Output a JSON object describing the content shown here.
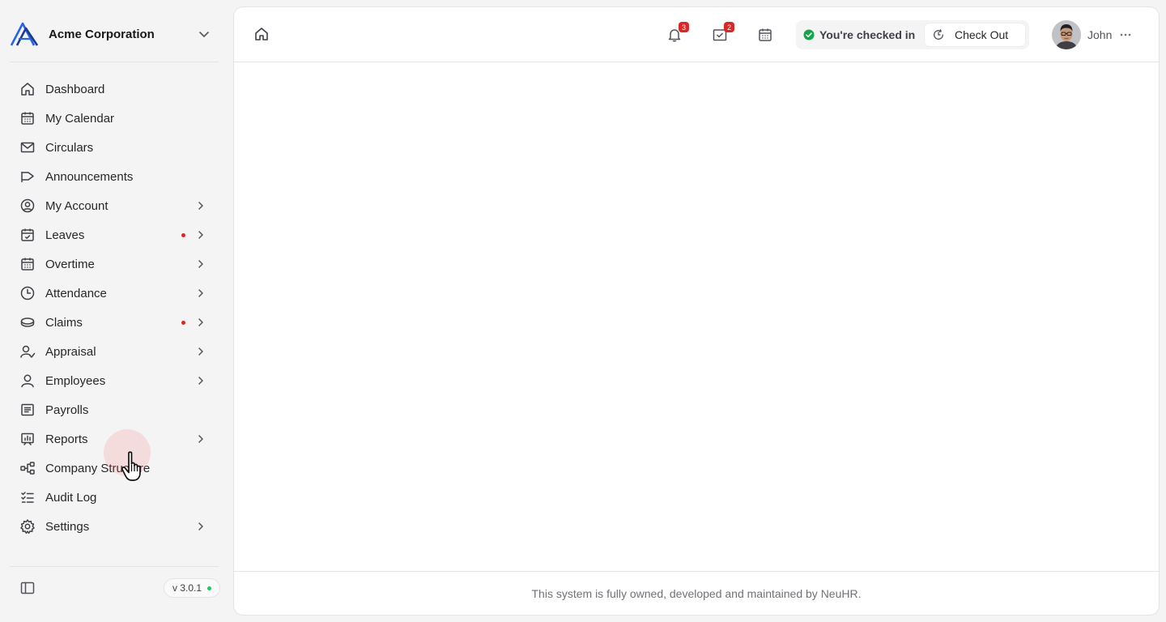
{
  "org": {
    "name": "Acme Corporation",
    "logo_color": "#2563eb"
  },
  "sidebar": {
    "items": [
      {
        "label": "Dashboard",
        "icon": "home-icon",
        "chevron": false,
        "dot": false
      },
      {
        "label": "My Calendar",
        "icon": "calendar-icon",
        "chevron": false,
        "dot": false
      },
      {
        "label": "Circulars",
        "icon": "mail-icon",
        "chevron": false,
        "dot": false
      },
      {
        "label": "Announcements",
        "icon": "megaphone-icon",
        "chevron": false,
        "dot": false
      },
      {
        "label": "My Account",
        "icon": "user-circle-icon",
        "chevron": true,
        "dot": false
      },
      {
        "label": "Leaves",
        "icon": "calendar-check-icon",
        "chevron": true,
        "dot": true
      },
      {
        "label": "Overtime",
        "icon": "calendar-grid-icon",
        "chevron": true,
        "dot": false
      },
      {
        "label": "Attendance",
        "icon": "clock-icon",
        "chevron": true,
        "dot": false
      },
      {
        "label": "Claims",
        "icon": "coins-icon",
        "chevron": true,
        "dot": true
      },
      {
        "label": "Appraisal",
        "icon": "user-check-icon",
        "chevron": true,
        "dot": false
      },
      {
        "label": "Employees",
        "icon": "user-icon",
        "chevron": true,
        "dot": false
      },
      {
        "label": "Payrolls",
        "icon": "receipt-icon",
        "chevron": false,
        "dot": false
      },
      {
        "label": "Reports",
        "icon": "report-chart-icon",
        "chevron": true,
        "dot": false
      },
      {
        "label": "Company Structure",
        "icon": "hierarchy-icon",
        "chevron": false,
        "dot": false
      },
      {
        "label": "Audit Log",
        "icon": "checklist-icon",
        "chevron": false,
        "dot": false
      },
      {
        "label": "Settings",
        "icon": "gear-icon",
        "chevron": true,
        "dot": false
      }
    ],
    "version": "v 3.0.1",
    "status_dot_color": "#22c55e",
    "alert_dot_color": "#dc2626"
  },
  "topbar": {
    "notifications_count": "3",
    "tasks_count": "2",
    "checkin_status": "You're checked in",
    "checkout_label": "Check Out",
    "user_name": "John"
  },
  "footer": {
    "text": "This system is fully owned, developed and maintained by NeuHR."
  }
}
